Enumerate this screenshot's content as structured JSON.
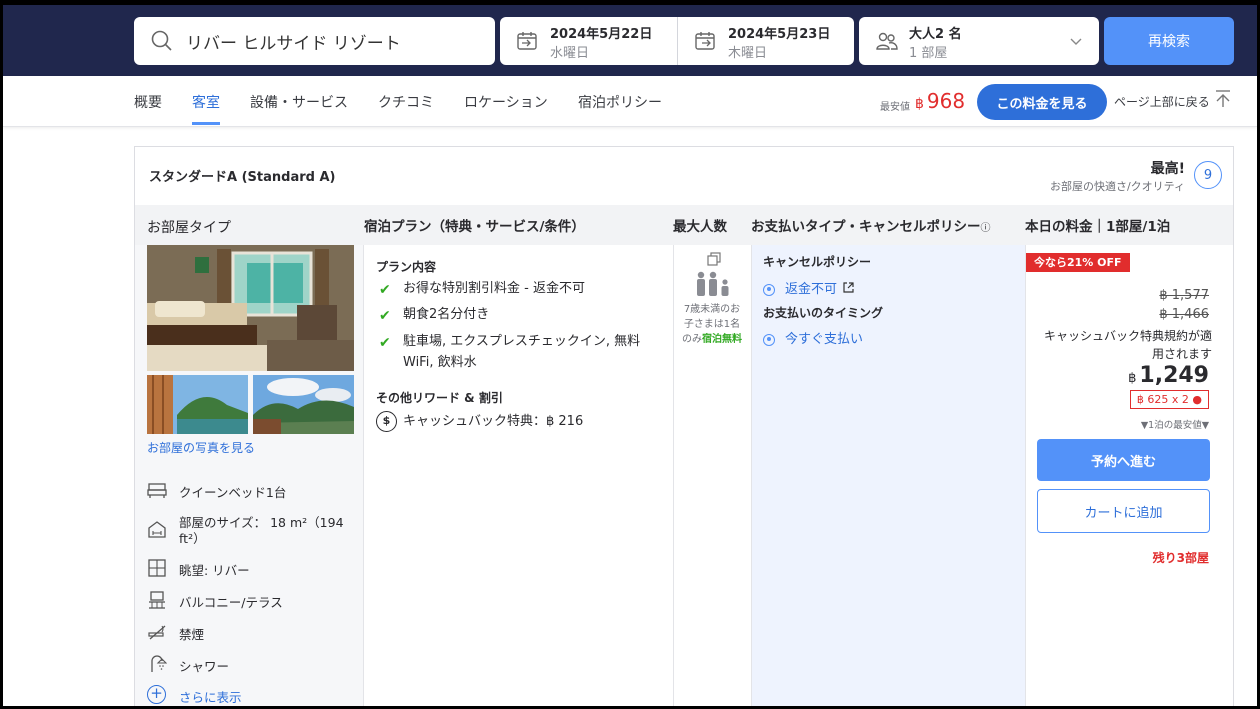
{
  "search": {
    "query": "リバー ヒルサイド リゾート",
    "checkin_date": "2024年5月22日",
    "checkin_day": "水曜日",
    "checkout_date": "2024年5月23日",
    "checkout_day": "木曜日",
    "guests": "大人2 名",
    "rooms": "1 部屋",
    "button": "再検索"
  },
  "nav": {
    "tabs": [
      "概要",
      "客室",
      "設備・サービス",
      "クチコミ",
      "ロケーション",
      "宿泊ポリシー"
    ],
    "active_tab": "客室",
    "lowest_label": "最安値",
    "lowest_currency": "฿",
    "lowest_price": "968",
    "see_price_button": "この料金を見る",
    "back_to_top": "ページ上部に戻る"
  },
  "room": {
    "title": "スタンダードA (Standard A)",
    "rating_word": "最高!",
    "rating_sub": "お部屋の快適さ/クオリティ",
    "rating_score": "9",
    "headers": {
      "room_type": "お部屋タイプ",
      "plan": "宿泊プラン（特典・サービス/条件）",
      "max_guests": "最大人数",
      "payment": "お支払いタイプ・キャンセルポリシー",
      "payment_info": "ⓘ",
      "price": "本日の料金｜1部屋/1泊"
    },
    "photos_link": "お部屋の写真を見る",
    "features": [
      {
        "icon": "bed-icon",
        "label": "クイーンベッド1台"
      },
      {
        "icon": "room-size-icon",
        "label": "部屋のサイズ： 18 m²（194 ft²）"
      },
      {
        "icon": "view-icon",
        "label": "眺望: リバー"
      },
      {
        "icon": "balcony-icon",
        "label": "バルコニー/テラス"
      },
      {
        "icon": "no-smoking-icon",
        "label": "禁煙"
      },
      {
        "icon": "shower-icon",
        "label": "シャワー"
      }
    ],
    "show_more": "さらに表示",
    "plan": {
      "heading": "プラン内容",
      "items": [
        "お得な特別割引料金 - 返金不可",
        "朝食2名分付き",
        "駐車場, エクスプレスチェックイン, 無料WiFi, 飲料水"
      ],
      "rewards_heading": "その他リワード & 割引",
      "cashback": "キャッシュバック特典：฿ 216"
    },
    "occupancy": {
      "note": "7歳未満のお子さまは1名のみ",
      "note_free": "宿泊無料"
    },
    "payment": {
      "cancel_heading": "キャンセルポリシー",
      "cancel_option": "返金不可",
      "timing_heading": "お支払いのタイミング",
      "timing_option": "今すぐ支払い"
    },
    "price": {
      "discount_badge": "今なら21% OFF",
      "original_1": "฿ 1,577",
      "original_2": "฿ 1,466",
      "cashback_note": "キャッシュバック特典規約が適用されます",
      "currency": "฿",
      "final": "1,249",
      "per_person": "฿ 625 x 2",
      "lowest_note": "▼1泊の最安値▼",
      "book_button": "予約へ進む",
      "cart_button": "カートに追加",
      "rooms_left": "残り3部屋"
    }
  },
  "colors": {
    "topbar": "#20274d",
    "accent": "#5392f9",
    "link": "#2e6fd9",
    "alert": "#e12d2d",
    "check": "#32a923"
  }
}
